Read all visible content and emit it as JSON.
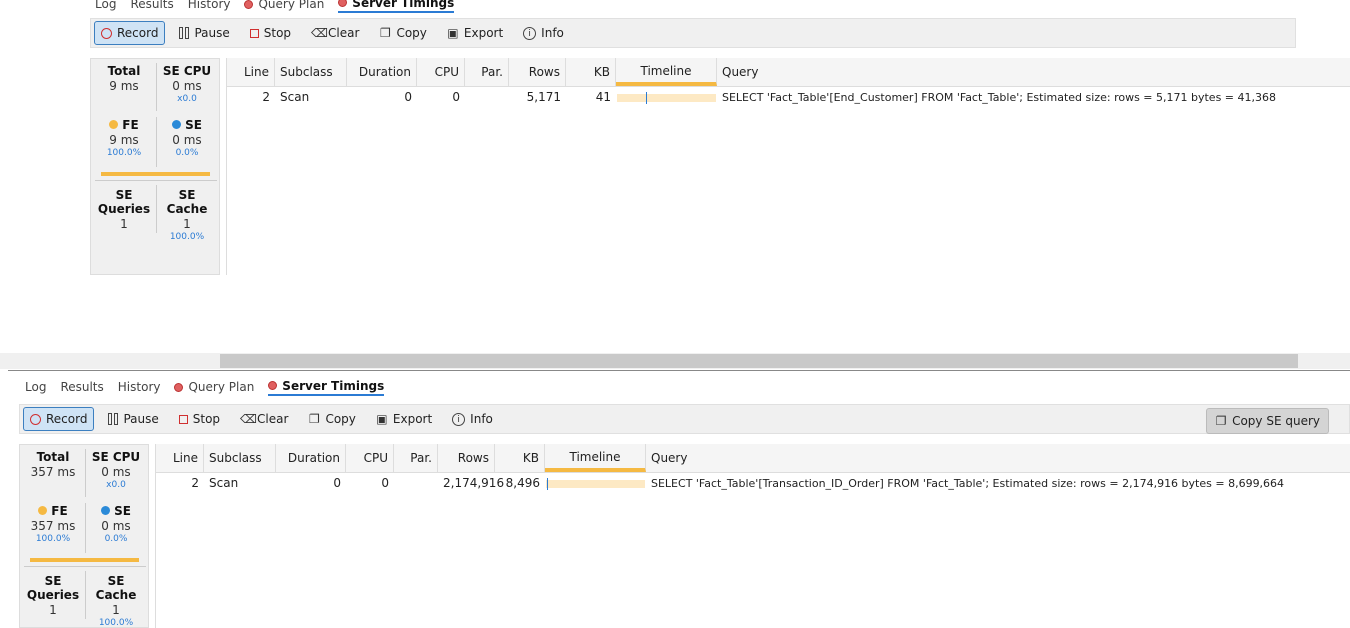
{
  "top": {
    "tabs": [
      "Log",
      "Results",
      "History",
      "Query Plan",
      "Server Timings"
    ],
    "toolbar": {
      "record": "Record",
      "pause": "Pause",
      "stop": "Stop",
      "clear": "Clear",
      "copy": "Copy",
      "export": "Export",
      "info": "Info"
    },
    "stats": {
      "total_label": "Total",
      "total_value": "9 ms",
      "secpu_label": "SE CPU",
      "secpu_value": "0 ms",
      "secpu_sub": "x0.0",
      "fe_label": "FE",
      "fe_value": "9 ms",
      "fe_pct": "100.0%",
      "se_label": "SE",
      "se_value": "0 ms",
      "se_pct": "0.0%",
      "sequeries_label": "SE Queries",
      "sequeries_value": "1",
      "secache_label": "SE Cache",
      "secache_value": "1",
      "secache_pct": "100.0%"
    },
    "columns": [
      "Line",
      "Subclass",
      "Duration",
      "CPU",
      "Par.",
      "Rows",
      "KB",
      "Timeline",
      "Query"
    ],
    "row": {
      "line": "2",
      "subclass": "Scan",
      "duration": "0",
      "cpu": "0",
      "par": "",
      "rows": "5,171",
      "kb": "41",
      "query": "SELECT 'Fact_Table'[End_Customer] FROM 'Fact_Table';   Estimated size: rows = 5,171  bytes = 41,368"
    }
  },
  "bottom": {
    "tabs": [
      "Log",
      "Results",
      "History",
      "Query Plan",
      "Server Timings"
    ],
    "toolbar": {
      "record": "Record",
      "pause": "Pause",
      "stop": "Stop",
      "clear": "Clear",
      "copy": "Copy",
      "export": "Export",
      "info": "Info",
      "copy_se": "Copy SE query"
    },
    "stats": {
      "total_label": "Total",
      "total_value": "357 ms",
      "secpu_label": "SE CPU",
      "secpu_value": "0 ms",
      "secpu_sub": "x0.0",
      "fe_label": "FE",
      "fe_value": "357 ms",
      "fe_pct": "100.0%",
      "se_label": "SE",
      "se_value": "0 ms",
      "se_pct": "0.0%",
      "sequeries_label": "SE Queries",
      "sequeries_value": "1",
      "secache_label": "SE Cache",
      "secache_value": "1",
      "secache_pct": "100.0%"
    },
    "columns": [
      "Line",
      "Subclass",
      "Duration",
      "CPU",
      "Par.",
      "Rows",
      "KB",
      "Timeline",
      "Query"
    ],
    "row": {
      "line": "2",
      "subclass": "Scan",
      "duration": "0",
      "cpu": "0",
      "par": "",
      "rows": "2,174,916",
      "kb": "8,496",
      "query": "SELECT 'Fact_Table'[Transaction_ID_Order] FROM 'Fact_Table';   Estimated size: rows = 2,174,916  bytes = 8,699,664"
    }
  }
}
